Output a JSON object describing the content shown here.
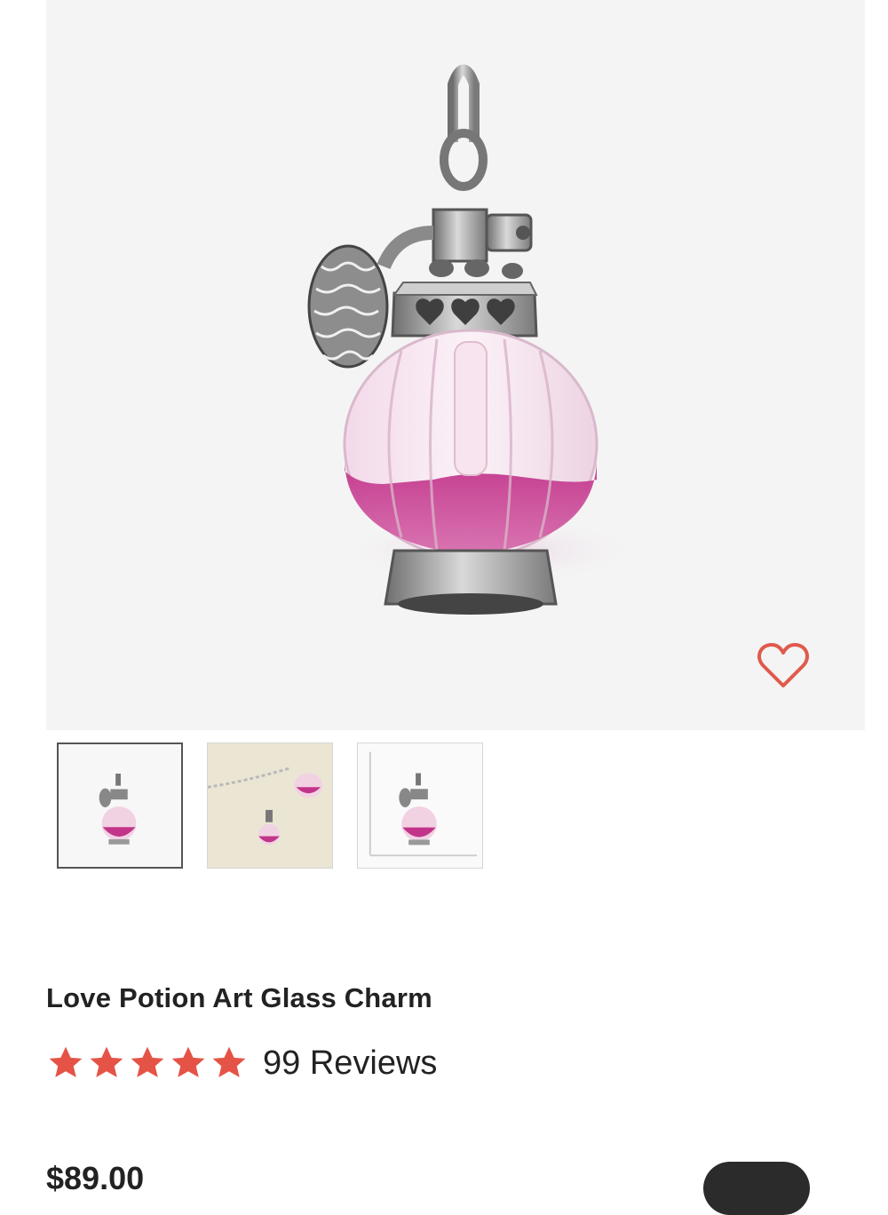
{
  "product": {
    "title": "Love Potion Art Glass Charm",
    "rating_stars": 5,
    "reviews_label": "99 Reviews",
    "price": "$89.00"
  },
  "gallery": {
    "thumbnails": [
      {
        "name": "front-view",
        "selected": true
      },
      {
        "name": "on-bracelet-view",
        "selected": false
      },
      {
        "name": "size-guide-view",
        "selected": false
      }
    ]
  },
  "colors": {
    "star": "#e55347",
    "heart": "#e05a4c",
    "pink_liquid": "#b8227d",
    "silver": "#a8a8a8"
  },
  "icons": {
    "favorite": "heart-outline-icon",
    "star": "star-icon"
  }
}
